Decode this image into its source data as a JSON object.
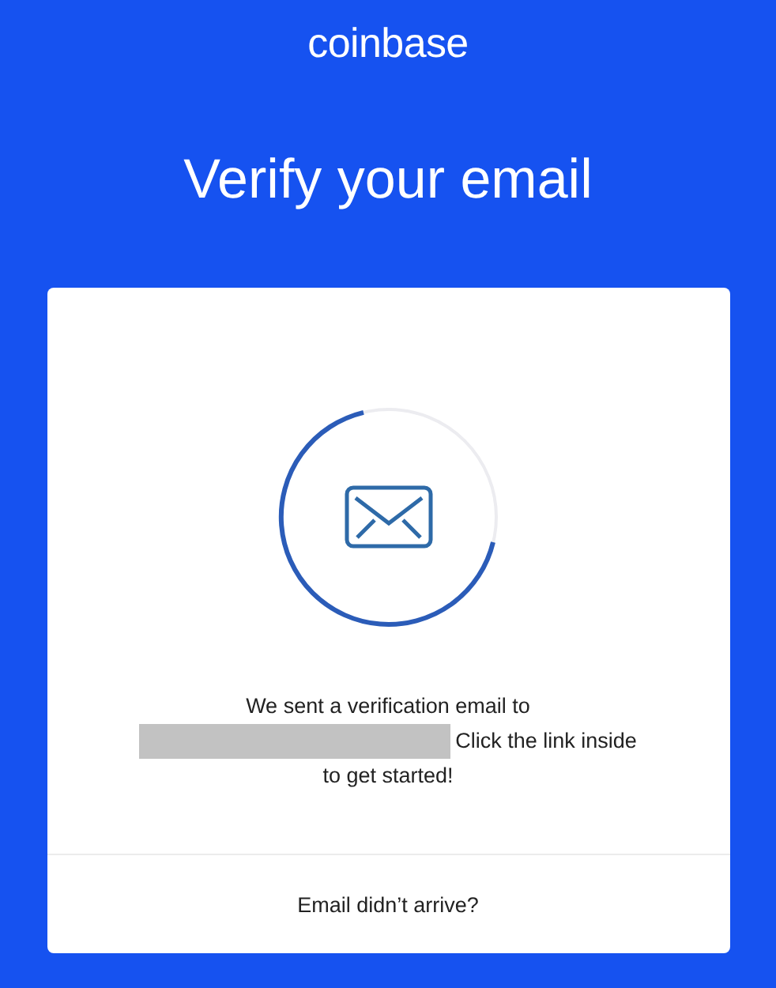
{
  "logo": "coinbase",
  "title": "Verify your email",
  "card": {
    "message_lines": [
      {
        "parts": [
          {
            "kind": "text",
            "text": "We sent a verification email to"
          }
        ]
      },
      {
        "parts": [
          {
            "kind": "redacted"
          },
          {
            "kind": "text",
            "text": "Click the link inside"
          }
        ]
      },
      {
        "parts": [
          {
            "kind": "text",
            "text": "to get started!"
          }
        ]
      }
    ],
    "footer_link": "Email didn’t arrive?"
  }
}
